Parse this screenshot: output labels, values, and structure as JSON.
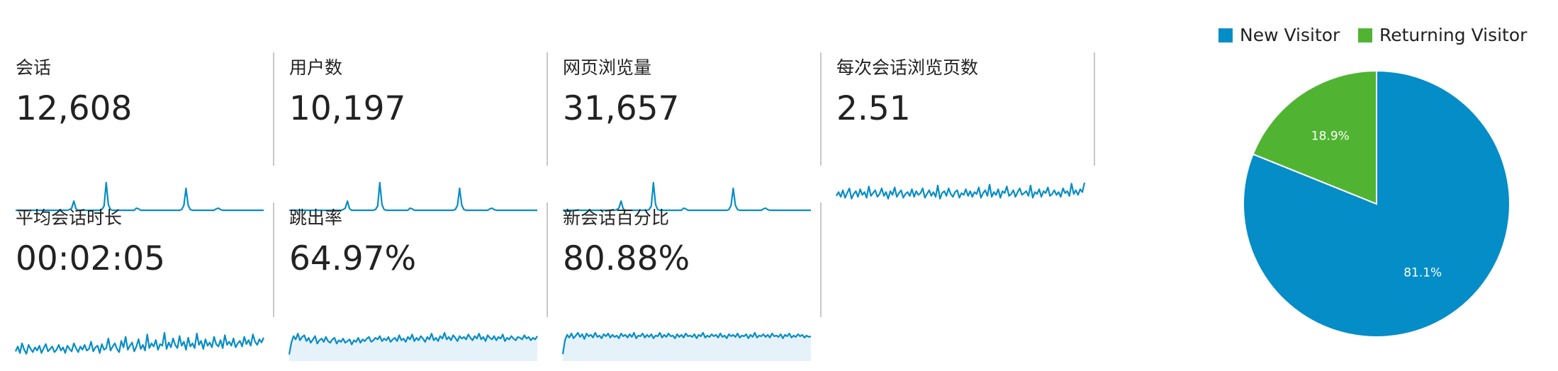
{
  "metrics": [
    {
      "id": "sessions",
      "label": "会话",
      "value": "12,608",
      "spark": [
        1,
        1,
        1,
        1,
        1,
        1,
        1,
        1,
        1,
        1,
        1,
        1,
        1,
        1,
        1,
        1,
        1,
        1,
        1,
        1,
        1,
        1,
        1,
        1,
        1,
        2,
        4,
        14,
        3,
        1,
        1,
        1,
        1,
        1,
        1,
        1,
        1,
        1,
        1,
        1,
        2,
        7,
        40,
        9,
        2,
        1,
        1,
        1,
        1,
        1,
        1,
        1,
        1,
        1,
        1,
        1,
        4,
        3,
        1,
        1,
        1,
        1,
        1,
        1,
        1,
        1,
        1,
        1,
        1,
        1,
        1,
        1,
        1,
        1,
        1,
        1,
        1,
        2,
        8,
        32,
        8,
        2,
        1,
        1,
        1,
        1,
        1,
        1,
        1,
        1,
        1,
        1,
        1,
        3,
        4,
        2,
        1,
        1,
        1,
        1,
        1,
        1,
        1,
        1,
        1,
        1,
        1,
        1,
        1,
        1,
        1,
        1,
        1,
        1,
        1,
        1
      ],
      "fill": false
    },
    {
      "id": "users",
      "label": "用户数",
      "value": "10,197",
      "spark": [
        1,
        1,
        1,
        1,
        1,
        1,
        1,
        1,
        1,
        1,
        1,
        1,
        1,
        1,
        1,
        1,
        1,
        1,
        1,
        1,
        1,
        1,
        1,
        1,
        1,
        2,
        4,
        14,
        3,
        1,
        1,
        1,
        1,
        1,
        1,
        1,
        1,
        1,
        1,
        1,
        2,
        7,
        40,
        9,
        2,
        1,
        1,
        1,
        1,
        1,
        1,
        1,
        1,
        1,
        1,
        1,
        4,
        3,
        1,
        1,
        1,
        1,
        1,
        1,
        1,
        1,
        1,
        1,
        1,
        1,
        1,
        1,
        1,
        1,
        1,
        1,
        1,
        2,
        8,
        32,
        8,
        2,
        1,
        1,
        1,
        1,
        1,
        1,
        1,
        1,
        1,
        1,
        1,
        3,
        4,
        2,
        1,
        1,
        1,
        1,
        1,
        1,
        1,
        1,
        1,
        1,
        1,
        1,
        1,
        1,
        1,
        1,
        1,
        1,
        1,
        1
      ],
      "fill": false
    },
    {
      "id": "pageviews",
      "label": "网页浏览量",
      "value": "31,657",
      "spark": [
        1,
        1,
        1,
        1,
        1,
        1,
        1,
        1,
        1,
        1,
        1,
        1,
        1,
        1,
        1,
        1,
        1,
        1,
        1,
        1,
        1,
        1,
        1,
        1,
        1,
        2,
        4,
        14,
        3,
        1,
        1,
        1,
        1,
        1,
        1,
        1,
        1,
        1,
        1,
        1,
        2,
        7,
        40,
        9,
        2,
        1,
        1,
        1,
        1,
        1,
        1,
        1,
        1,
        1,
        1,
        1,
        4,
        3,
        1,
        1,
        1,
        1,
        1,
        1,
        1,
        1,
        1,
        1,
        1,
        1,
        1,
        1,
        1,
        1,
        1,
        1,
        1,
        2,
        8,
        32,
        8,
        2,
        1,
        1,
        1,
        1,
        1,
        1,
        1,
        1,
        1,
        1,
        1,
        3,
        4,
        2,
        1,
        1,
        1,
        1,
        1,
        1,
        1,
        1,
        1,
        1,
        1,
        1,
        1,
        1,
        1,
        1,
        1,
        1,
        1,
        1
      ],
      "fill": false
    },
    {
      "id": "pages_per_session",
      "label": "每次会话浏览页数",
      "value": "2.51",
      "spark": [
        16,
        20,
        15,
        22,
        14,
        19,
        24,
        13,
        18,
        21,
        15,
        23,
        17,
        20,
        14,
        26,
        16,
        19,
        22,
        15,
        18,
        24,
        16,
        20,
        13,
        21,
        17,
        25,
        15,
        19,
        22,
        14,
        18,
        20,
        16,
        23,
        15,
        21,
        17,
        19,
        24,
        14,
        18,
        22,
        16,
        20,
        15,
        27,
        13,
        19,
        21,
        16,
        24,
        18,
        15,
        20,
        22,
        14,
        19,
        17,
        23,
        16,
        21,
        15,
        20,
        18,
        25,
        14,
        19,
        22,
        16,
        28,
        15,
        20,
        17,
        23,
        14,
        21,
        19,
        26,
        16,
        18,
        22,
        15,
        20,
        24,
        17,
        19,
        21,
        16,
        27,
        14,
        20,
        18,
        23,
        15,
        21,
        19,
        25,
        16,
        18,
        22,
        17,
        20,
        15,
        24,
        19,
        21,
        16,
        29,
        18,
        22,
        17,
        23,
        20,
        30
      ],
      "fill": false
    },
    {
      "id": "avg_duration",
      "label": "平均会话时长",
      "value": "00:02:05",
      "spark": [
        12,
        18,
        10,
        22,
        14,
        9,
        20,
        15,
        11,
        17,
        13,
        19,
        10,
        16,
        21,
        12,
        15,
        18,
        11,
        14,
        20,
        13,
        17,
        10,
        19,
        15,
        12,
        22,
        16,
        11,
        18,
        14,
        20,
        13,
        15,
        24,
        12,
        17,
        19,
        10,
        21,
        14,
        16,
        28,
        13,
        18,
        22,
        15,
        11,
        25,
        17,
        30,
        14,
        19,
        23,
        12,
        18,
        27,
        15,
        20,
        13,
        33,
        16,
        22,
        18,
        26,
        14,
        21,
        19,
        35,
        15,
        23,
        17,
        28,
        20,
        16,
        31,
        19,
        24,
        14,
        29,
        18,
        22,
        16,
        34,
        20,
        25,
        15,
        27,
        19,
        23,
        17,
        30,
        21,
        18,
        26,
        16,
        32,
        20,
        24,
        19,
        28,
        17,
        22,
        25,
        18,
        30,
        21,
        26,
        19,
        33,
        24,
        20,
        27,
        23,
        29
      ],
      "fill": false
    },
    {
      "id": "bounce_rate",
      "label": "跳出率",
      "value": "64.97%",
      "spark": [
        8,
        22,
        30,
        26,
        33,
        25,
        29,
        31,
        24,
        28,
        22,
        26,
        30,
        21,
        25,
        27,
        23,
        29,
        24,
        22,
        26,
        28,
        21,
        25,
        23,
        27,
        22,
        24,
        26,
        20,
        25,
        23,
        28,
        22,
        26,
        24,
        27,
        29,
        23,
        25,
        28,
        26,
        30,
        24,
        27,
        25,
        29,
        23,
        26,
        28,
        24,
        31,
        25,
        27,
        23,
        29,
        26,
        32,
        24,
        28,
        25,
        30,
        27,
        23,
        29,
        26,
        33,
        25,
        28,
        24,
        30,
        27,
        34,
        26,
        29,
        25,
        31,
        28,
        24,
        30,
        27,
        29,
        26,
        32,
        28,
        25,
        30,
        27,
        33,
        26,
        29,
        24,
        31,
        28,
        26,
        30,
        25,
        29,
        27,
        32,
        24,
        28,
        26,
        30,
        27,
        25,
        29,
        28,
        26,
        31,
        27,
        29,
        25,
        28,
        26,
        30
      ],
      "fill": true
    },
    {
      "id": "new_sessions_pct",
      "label": "新会话百分比",
      "value": "80.88%",
      "spark": [
        10,
        30,
        38,
        34,
        40,
        33,
        37,
        41,
        35,
        39,
        32,
        40,
        36,
        38,
        34,
        41,
        35,
        37,
        33,
        39,
        36,
        40,
        34,
        38,
        35,
        37,
        33,
        40,
        36,
        38,
        34,
        39,
        35,
        41,
        33,
        37,
        36,
        40,
        34,
        38,
        35,
        39,
        33,
        37,
        36,
        41,
        34,
        38,
        35,
        40,
        36,
        37,
        33,
        39,
        35,
        38,
        34,
        40,
        36,
        37,
        35,
        39,
        33,
        38,
        36,
        41,
        34,
        37,
        35,
        39,
        36,
        38,
        34,
        40,
        35,
        37,
        33,
        39,
        36,
        38,
        35,
        40,
        34,
        37,
        36,
        39,
        33,
        38,
        35,
        41,
        34,
        37,
        36,
        39,
        35,
        38,
        34,
        40,
        36,
        37,
        35,
        39,
        33,
        38,
        36,
        40,
        34,
        37,
        35,
        39,
        36,
        38,
        34,
        37,
        35,
        36
      ],
      "fill": true
    }
  ],
  "chart_data": {
    "type": "pie",
    "legend": [
      "New Visitor",
      "Returning Visitor"
    ],
    "legend_position": "top",
    "slices": [
      {
        "name": "New Visitor",
        "value": 81.1,
        "label": "81.1%",
        "color": "#058dc7"
      },
      {
        "name": "Returning Visitor",
        "value": 18.9,
        "label": "18.9%",
        "color": "#50b432"
      }
    ]
  },
  "colors": {
    "spark_line": "#058dc7",
    "spark_fill": "#e6f2fa",
    "divider": "#c8c8c8"
  }
}
